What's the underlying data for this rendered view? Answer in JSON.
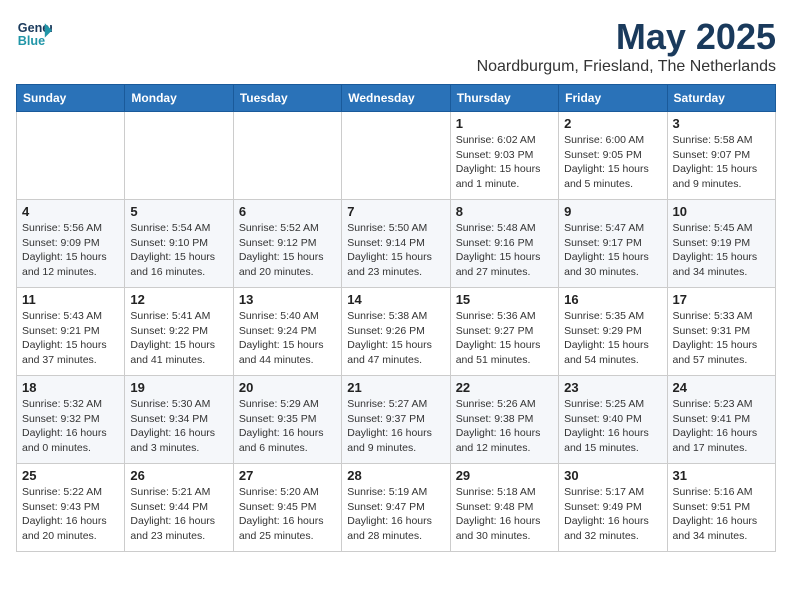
{
  "header": {
    "logo_line1": "General",
    "logo_line2": "Blue",
    "month": "May 2025",
    "location": "Noardburgum, Friesland, The Netherlands"
  },
  "weekdays": [
    "Sunday",
    "Monday",
    "Tuesday",
    "Wednesday",
    "Thursday",
    "Friday",
    "Saturday"
  ],
  "weeks": [
    [
      {
        "day": "",
        "info": ""
      },
      {
        "day": "",
        "info": ""
      },
      {
        "day": "",
        "info": ""
      },
      {
        "day": "",
        "info": ""
      },
      {
        "day": "1",
        "info": "Sunrise: 6:02 AM\nSunset: 9:03 PM\nDaylight: 15 hours\nand 1 minute."
      },
      {
        "day": "2",
        "info": "Sunrise: 6:00 AM\nSunset: 9:05 PM\nDaylight: 15 hours\nand 5 minutes."
      },
      {
        "day": "3",
        "info": "Sunrise: 5:58 AM\nSunset: 9:07 PM\nDaylight: 15 hours\nand 9 minutes."
      }
    ],
    [
      {
        "day": "4",
        "info": "Sunrise: 5:56 AM\nSunset: 9:09 PM\nDaylight: 15 hours\nand 12 minutes."
      },
      {
        "day": "5",
        "info": "Sunrise: 5:54 AM\nSunset: 9:10 PM\nDaylight: 15 hours\nand 16 minutes."
      },
      {
        "day": "6",
        "info": "Sunrise: 5:52 AM\nSunset: 9:12 PM\nDaylight: 15 hours\nand 20 minutes."
      },
      {
        "day": "7",
        "info": "Sunrise: 5:50 AM\nSunset: 9:14 PM\nDaylight: 15 hours\nand 23 minutes."
      },
      {
        "day": "8",
        "info": "Sunrise: 5:48 AM\nSunset: 9:16 PM\nDaylight: 15 hours\nand 27 minutes."
      },
      {
        "day": "9",
        "info": "Sunrise: 5:47 AM\nSunset: 9:17 PM\nDaylight: 15 hours\nand 30 minutes."
      },
      {
        "day": "10",
        "info": "Sunrise: 5:45 AM\nSunset: 9:19 PM\nDaylight: 15 hours\nand 34 minutes."
      }
    ],
    [
      {
        "day": "11",
        "info": "Sunrise: 5:43 AM\nSunset: 9:21 PM\nDaylight: 15 hours\nand 37 minutes."
      },
      {
        "day": "12",
        "info": "Sunrise: 5:41 AM\nSunset: 9:22 PM\nDaylight: 15 hours\nand 41 minutes."
      },
      {
        "day": "13",
        "info": "Sunrise: 5:40 AM\nSunset: 9:24 PM\nDaylight: 15 hours\nand 44 minutes."
      },
      {
        "day": "14",
        "info": "Sunrise: 5:38 AM\nSunset: 9:26 PM\nDaylight: 15 hours\nand 47 minutes."
      },
      {
        "day": "15",
        "info": "Sunrise: 5:36 AM\nSunset: 9:27 PM\nDaylight: 15 hours\nand 51 minutes."
      },
      {
        "day": "16",
        "info": "Sunrise: 5:35 AM\nSunset: 9:29 PM\nDaylight: 15 hours\nand 54 minutes."
      },
      {
        "day": "17",
        "info": "Sunrise: 5:33 AM\nSunset: 9:31 PM\nDaylight: 15 hours\nand 57 minutes."
      }
    ],
    [
      {
        "day": "18",
        "info": "Sunrise: 5:32 AM\nSunset: 9:32 PM\nDaylight: 16 hours\nand 0 minutes."
      },
      {
        "day": "19",
        "info": "Sunrise: 5:30 AM\nSunset: 9:34 PM\nDaylight: 16 hours\nand 3 minutes."
      },
      {
        "day": "20",
        "info": "Sunrise: 5:29 AM\nSunset: 9:35 PM\nDaylight: 16 hours\nand 6 minutes."
      },
      {
        "day": "21",
        "info": "Sunrise: 5:27 AM\nSunset: 9:37 PM\nDaylight: 16 hours\nand 9 minutes."
      },
      {
        "day": "22",
        "info": "Sunrise: 5:26 AM\nSunset: 9:38 PM\nDaylight: 16 hours\nand 12 minutes."
      },
      {
        "day": "23",
        "info": "Sunrise: 5:25 AM\nSunset: 9:40 PM\nDaylight: 16 hours\nand 15 minutes."
      },
      {
        "day": "24",
        "info": "Sunrise: 5:23 AM\nSunset: 9:41 PM\nDaylight: 16 hours\nand 17 minutes."
      }
    ],
    [
      {
        "day": "25",
        "info": "Sunrise: 5:22 AM\nSunset: 9:43 PM\nDaylight: 16 hours\nand 20 minutes."
      },
      {
        "day": "26",
        "info": "Sunrise: 5:21 AM\nSunset: 9:44 PM\nDaylight: 16 hours\nand 23 minutes."
      },
      {
        "day": "27",
        "info": "Sunrise: 5:20 AM\nSunset: 9:45 PM\nDaylight: 16 hours\nand 25 minutes."
      },
      {
        "day": "28",
        "info": "Sunrise: 5:19 AM\nSunset: 9:47 PM\nDaylight: 16 hours\nand 28 minutes."
      },
      {
        "day": "29",
        "info": "Sunrise: 5:18 AM\nSunset: 9:48 PM\nDaylight: 16 hours\nand 30 minutes."
      },
      {
        "day": "30",
        "info": "Sunrise: 5:17 AM\nSunset: 9:49 PM\nDaylight: 16 hours\nand 32 minutes."
      },
      {
        "day": "31",
        "info": "Sunrise: 5:16 AM\nSunset: 9:51 PM\nDaylight: 16 hours\nand 34 minutes."
      }
    ]
  ]
}
